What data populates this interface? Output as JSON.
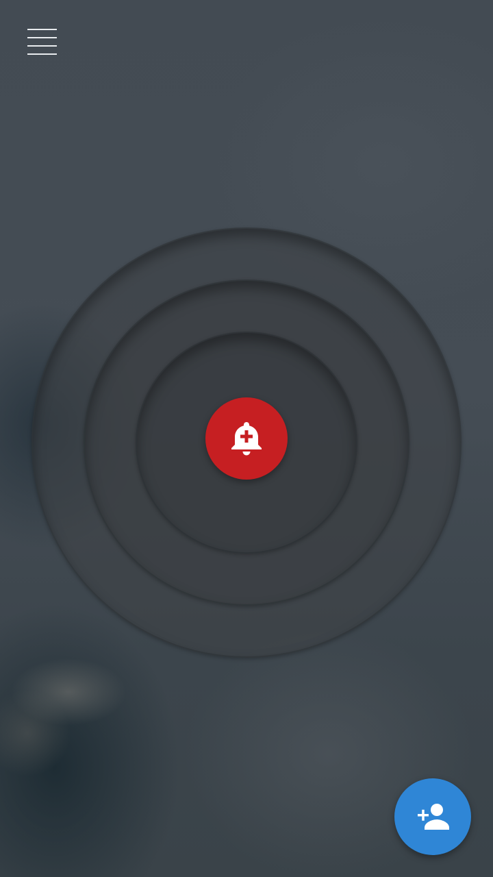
{
  "screen": {
    "background": "misty-mountain-photo"
  },
  "header": {
    "menu_icon": "hamburger-menu-icon"
  },
  "main": {
    "alarm_button": {
      "icon": "alarm-add-bell-icon",
      "color": "#c61f22"
    },
    "rings": 3
  },
  "fab": {
    "icon": "person-add-icon",
    "color": "#2f86d6"
  }
}
